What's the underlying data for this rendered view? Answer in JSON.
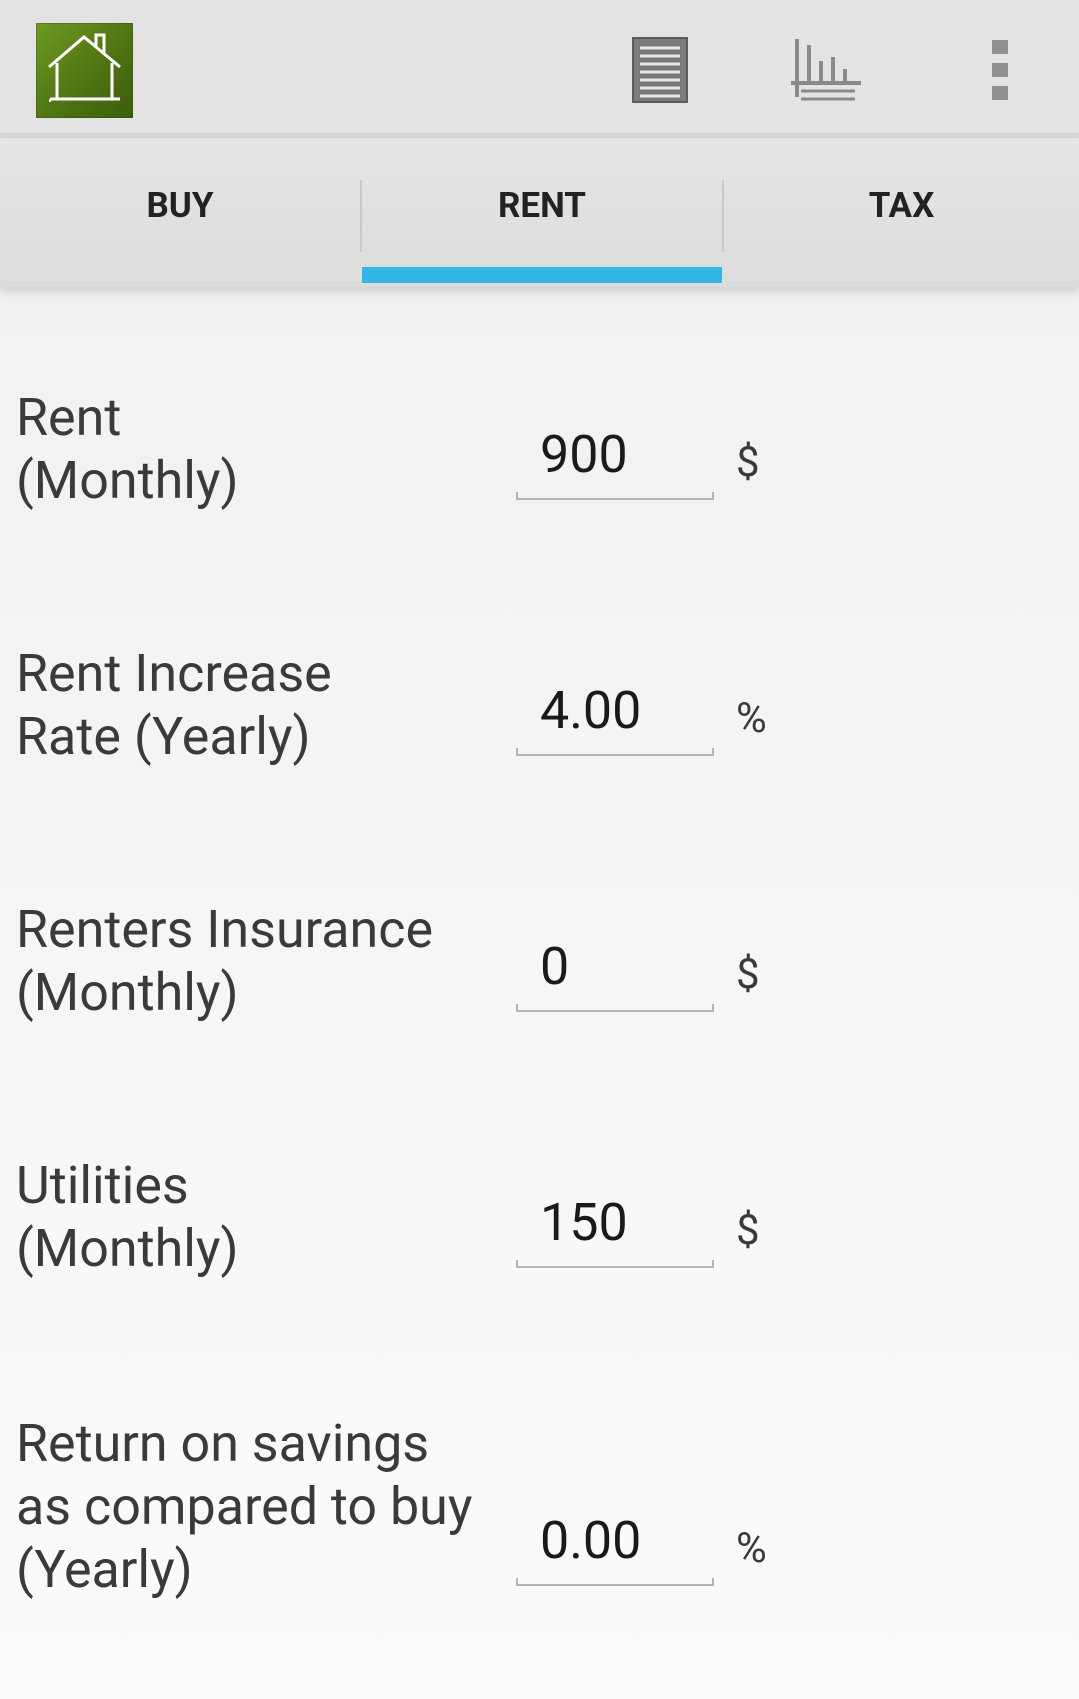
{
  "action_bar": {
    "icons": {
      "app_logo": "house-icon",
      "summary": "list-icon",
      "chart": "bar-chart-icon",
      "overflow": "more-vert-icon"
    },
    "logo_color": "#557a17"
  },
  "tabs": [
    {
      "label": "BUY",
      "selected": false
    },
    {
      "label": "RENT",
      "selected": true
    },
    {
      "label": "TAX",
      "selected": false
    }
  ],
  "accent_color": "#33b5e5",
  "form": {
    "rows": [
      {
        "label_lines": [
          "Rent",
          "(Monthly)"
        ],
        "value": "900",
        "unit": "$"
      },
      {
        "label_lines": [
          "Rent Increase",
          "Rate (Yearly)"
        ],
        "value": "4.00",
        "unit": "%"
      },
      {
        "label_lines": [
          "Renters Insurance",
          "(Monthly)"
        ],
        "value": "0",
        "unit": "$"
      },
      {
        "label_lines": [
          "Utilities",
          "(Monthly)"
        ],
        "value": "150",
        "unit": "$"
      },
      {
        "label_lines": [
          "Return on savings",
          "as compared to buy",
          "(Yearly)"
        ],
        "value": "0.00",
        "unit": "%"
      }
    ]
  }
}
